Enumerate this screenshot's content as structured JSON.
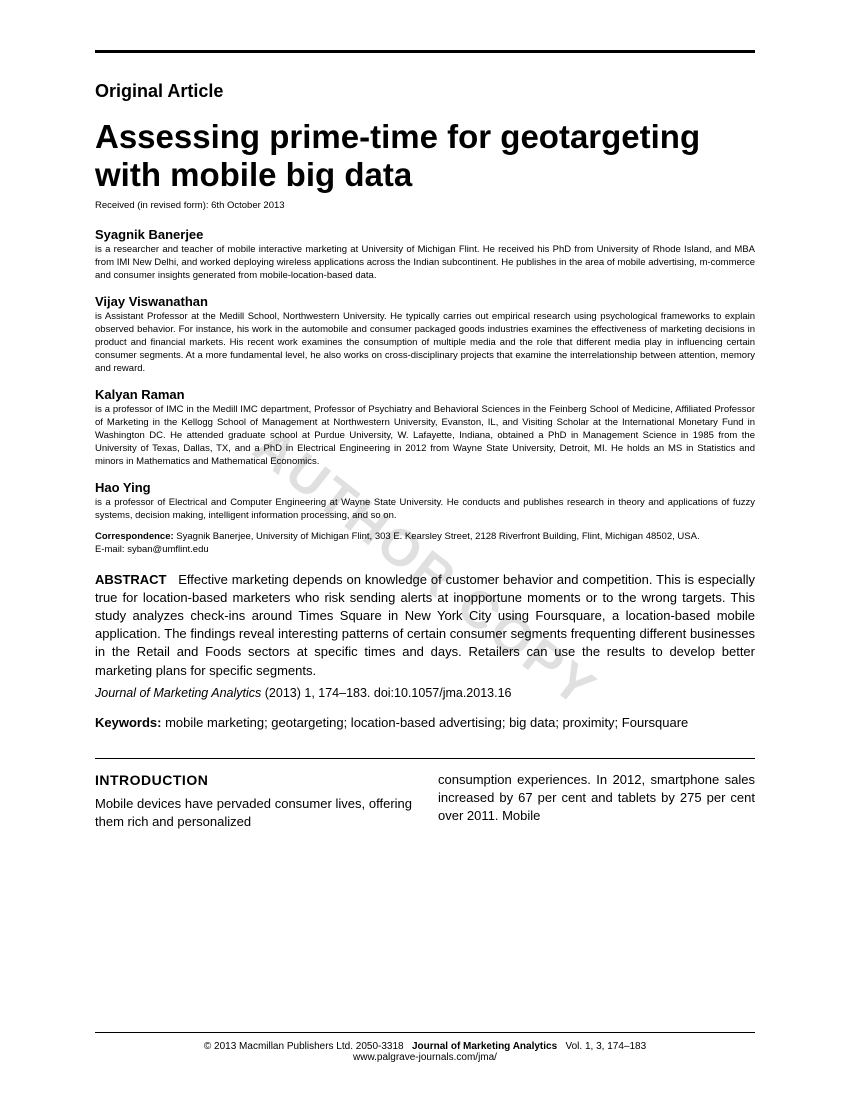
{
  "watermark": "AUTHOR COPY",
  "article_type": "Original Article",
  "title": "Assessing prime-time for geotargeting with mobile big data",
  "received": "Received (in revised form): 6th October 2013",
  "authors": [
    {
      "name": "Syagnik Banerjee",
      "bio": "is a researcher and teacher of mobile interactive marketing at University of Michigan Flint. He received his PhD from University of Rhode Island, and MBA from IMI New Delhi, and worked deploying wireless applications across the Indian subcontinent. He publishes in the area of mobile advertising, m-commerce and consumer insights generated from mobile-location-based data."
    },
    {
      "name": "Vijay Viswanathan",
      "bio": "is Assistant Professor at the Medill School, Northwestern University. He typically carries out empirical research using psychological frameworks to explain observed behavior. For instance, his work in the automobile and consumer packaged goods industries examines the effectiveness of marketing decisions in product and financial markets. His recent work examines the consumption of multiple media and the role that different media play in influencing certain consumer segments. At a more fundamental level, he also works on cross-disciplinary projects that examine the interrelationship between attention, memory and reward."
    },
    {
      "name": "Kalyan Raman",
      "bio": "is a professor of IMC in the Medill IMC department, Professor of Psychiatry and Behavioral Sciences in the Feinberg School of Medicine, Affiliated Professor of Marketing in the Kellogg School of Management at Northwestern University, Evanston, IL, and Visiting Scholar at the International Monetary Fund in Washington DC. He attended graduate school at Purdue University, W. Lafayette, Indiana, obtained a PhD in Management Science in 1985 from the University of Texas, Dallas, TX, and a PhD in Electrical Engineering in 2012 from Wayne State University, Detroit, MI. He holds an MS in Statistics and minors in Mathematics and Mathematical Economics."
    },
    {
      "name": "Hao Ying",
      "bio": "is a professor of Electrical and Computer Engineering at Wayne State University. He conducts and publishes research in theory and applications of fuzzy systems, decision making, intelligent information processing, and so on."
    }
  ],
  "correspondence": {
    "line1": "Correspondence: Syagnik Banerjee, University of Michigan Flint, 303 E. Kearsley Street, 2128 Riverfront Building, Flint, Michigan 48502, USA.",
    "line2": "E-mail: syban@umflint.edu"
  },
  "abstract": {
    "label": "ABSTRACT",
    "text": "Effective marketing depends on knowledge of customer behavior and competition. This is especially true for location-based marketers who risk sending alerts at inopportune moments or to the wrong targets. This study analyzes check-ins around Times Square in New York City using Foursquare, a location-based mobile application. The findings reveal interesting patterns of certain consumer segments frequenting different businesses in the Retail and Foods sectors at specific times and days. Retailers can use the results to develop better marketing plans for specific segments."
  },
  "citation": {
    "journal": "Journal of Marketing Analytics",
    "tail": "(2013) 1, 174–183. doi:10.1057/jma.2013.16"
  },
  "keywords": {
    "label": "Keywords:",
    "text": "mobile marketing; geotargeting; location-based advertising; big data; proximity; Foursquare"
  },
  "body": {
    "heading": "INTRODUCTION",
    "col1": "Mobile devices have pervaded consumer lives, offering them rich and personalized",
    "col2": "consumption experiences. In 2012, smartphone sales increased by 67 per cent and tablets by 275 per cent over 2011. Mobile"
  },
  "footer": {
    "line1_left": "© 2013 Macmillan Publishers Ltd. 2050-3318",
    "line1_journal": "Journal of Marketing Analytics",
    "line1_right": "Vol. 1, 3, 174–183",
    "line2": "www.palgrave-journals.com/jma/"
  }
}
